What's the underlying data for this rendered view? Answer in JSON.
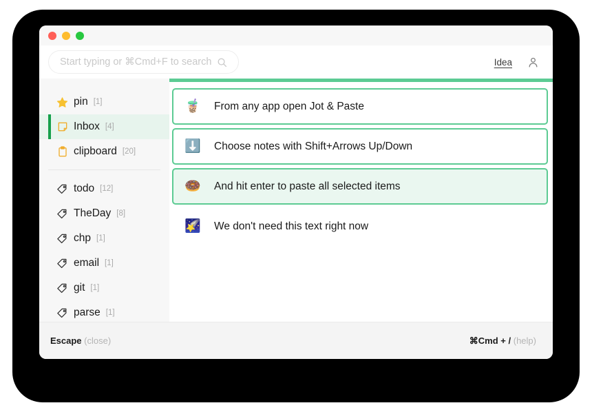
{
  "window": {
    "traffic_lights": [
      "close",
      "minimize",
      "zoom"
    ]
  },
  "search": {
    "placeholder": "Start typing or ⌘Cmd+F to search",
    "value": "",
    "icon": "search-icon"
  },
  "header": {
    "idea_link": "Idea",
    "account_icon": "person-icon"
  },
  "sidebar": {
    "pinned": [
      {
        "icon": "star-icon",
        "label": "pin",
        "count": "[1]",
        "active": false
      },
      {
        "icon": "note-icon",
        "label": "Inbox",
        "count": "[4]",
        "active": true
      },
      {
        "icon": "clipboard-icon",
        "label": "clipboard",
        "count": "[20]",
        "active": false
      }
    ],
    "tags": [
      {
        "icon": "tag-icon",
        "label": "todo",
        "count": "[12]"
      },
      {
        "icon": "tag-icon",
        "label": "TheDay",
        "count": "[8]"
      },
      {
        "icon": "tag-icon",
        "label": "chp",
        "count": "[1]"
      },
      {
        "icon": "tag-icon",
        "label": "email",
        "count": "[1]"
      },
      {
        "icon": "tag-icon",
        "label": "git",
        "count": "[1]"
      },
      {
        "icon": "tag-icon",
        "label": "parse",
        "count": "[1]"
      }
    ]
  },
  "main": {
    "notes": [
      {
        "emoji": "🧋",
        "emoji_name": "bubble-tea-icon",
        "text": "From any app open Jot & Paste",
        "state": "bordered"
      },
      {
        "emoji": "⬇️",
        "emoji_name": "down-arrow-icon",
        "text": "Choose notes with Shift+Arrows Up/Down",
        "state": "bordered"
      },
      {
        "emoji": "🍩",
        "emoji_name": "doughnut-icon",
        "text": "And hit enter to paste all selected items",
        "state": "selected"
      },
      {
        "emoji": "🌠",
        "emoji_name": "shooting-star-icon",
        "text": "We don't need this text right now",
        "state": "plain"
      }
    ]
  },
  "footer": {
    "left_key": "Escape",
    "left_note": "(close)",
    "right_key": "⌘Cmd + /",
    "right_note": "(help)"
  },
  "colors": {
    "accent_green": "#5ccb93",
    "active_green": "#15a04b",
    "selected_bg": "#eaf7f0",
    "sidebar_bg": "#f7f7f7",
    "footer_bg": "#f4f4f4"
  }
}
